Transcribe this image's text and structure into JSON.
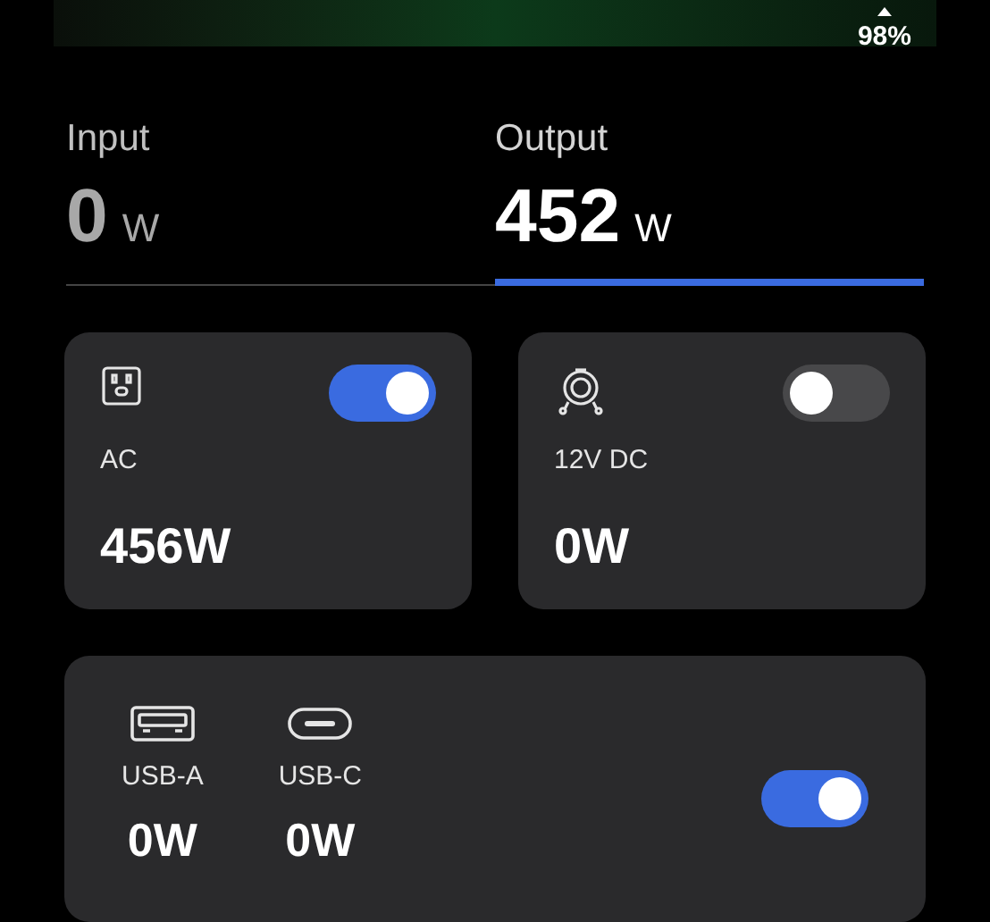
{
  "battery": {
    "percent": "98%"
  },
  "tabs": [
    {
      "label": "Input",
      "value": "0",
      "unit": "W",
      "selected": false
    },
    {
      "label": "Output",
      "value": "452",
      "unit": "W",
      "selected": true
    }
  ],
  "outputs": [
    {
      "kind": "ac",
      "label": "AC",
      "power": "456W",
      "on": true
    },
    {
      "kind": "dc",
      "label": "12V DC",
      "power": "0W",
      "on": false
    }
  ],
  "usb": {
    "on": true,
    "ports": [
      {
        "kind": "usb-a",
        "label": "USB-A",
        "power": "0W"
      },
      {
        "kind": "usb-c",
        "label": "USB-C",
        "power": "0W"
      }
    ]
  }
}
